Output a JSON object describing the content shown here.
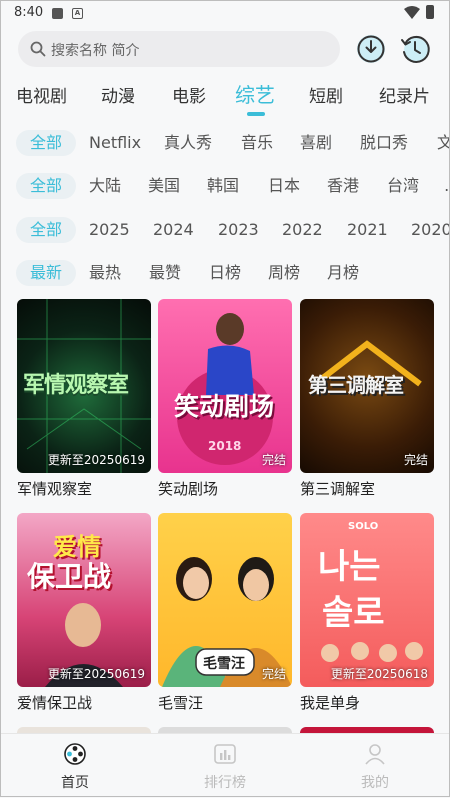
{
  "status": {
    "time": "8:40",
    "notif_letter": "A"
  },
  "search": {
    "placeholder": "搜索名称 简介"
  },
  "categories": [
    "电视剧",
    "动漫",
    "电影",
    "综艺",
    "短剧",
    "纪录片"
  ],
  "active_category": "综艺",
  "filters": {
    "genre": [
      "全部",
      "Netflix",
      "真人秀",
      "音乐",
      "喜剧",
      "脱口秀",
      "文"
    ],
    "region": [
      "全部",
      "大陆",
      "美国",
      "韩国",
      "日本",
      "香港",
      "台湾",
      "…"
    ],
    "year": [
      "全部",
      "2025",
      "2024",
      "2023",
      "2022",
      "2021",
      "2020"
    ],
    "sort": [
      "最新",
      "最热",
      "最赞",
      "日榜",
      "周榜",
      "月榜"
    ]
  },
  "items": [
    {
      "title": "军情观察室",
      "badge": "更新至20250619",
      "poster_text": "军情观察室"
    },
    {
      "title": "笑动剧场",
      "badge": "完结",
      "poster_text": "笑动剧场",
      "poster_sub": "2018"
    },
    {
      "title": "第三调解室",
      "badge": "完结",
      "poster_text": "第三调解室"
    },
    {
      "title": "爱情保卫战",
      "badge": "更新至20250619",
      "poster_text": "爱情",
      "poster_text2": "保卫战"
    },
    {
      "title": "毛雪汪",
      "badge": "完结",
      "poster_text": "毛雪汪"
    },
    {
      "title": "我是单身",
      "badge": "更新至20250618",
      "poster_text": "나는",
      "poster_text2": "솔로",
      "poster_sub": "SOLO"
    }
  ],
  "bottom_nav": [
    "首页",
    "排行榜",
    "我的"
  ],
  "colors": {
    "accent": "#3bbdd8",
    "chip_bg": "#eaf0f3",
    "background": "#f7f8f9"
  }
}
